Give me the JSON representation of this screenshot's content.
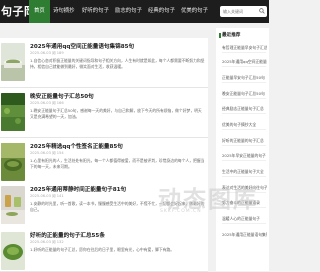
{
  "nav": {
    "logo": "句子岡",
    "items": [
      "首页",
      "诗句摘抄",
      "好听的句子",
      "励志的句子",
      "经典的句子",
      "优美的句子"
    ],
    "active_index": 0
  },
  "search": {
    "placeholder": "输入关键词"
  },
  "articles": [
    {
      "title": "2025年通用qq空间正能量语句集锦85句",
      "meta": "2025-06-03   阅 189",
      "excerpt": "1.自信心态对积极正能量的关键词指导和句子相关方向，人生有时就是如此，每个人都需要不断努力和坚持，相信自己就能做到最好，微笑面对生活，收获温暖。"
    },
    {
      "title": "晚安正能量句子汇总50句",
      "meta": "2025-06-03   阅 166",
      "excerpt": "1.晚安正能量句子汇总50句，感谢每一天的美好，与自己和解，放下今天的所有烦恼，做个好梦，明天又是充满希望的一天，加油。"
    },
    {
      "title": "2025年精选qq个性签名正能量85句",
      "meta": "2025-06-03   阅 154",
      "excerpt": "1.心里有阳光的人，生活处处有阳光，每一个人都值得被爱，而不是被评判，珍惜身边的每个人，把握当下的每一天，未来可期。"
    },
    {
      "title": "2025年通用蒂静时间正能量句子81句",
      "meta": "2025-06-03   阅 141",
      "excerpt": "1.安静的时光里，听一首歌，读一本书，慢慢感受生活中的美好，不慌不忙，一切都会好起来，做最好的自己。"
    },
    {
      "title": "好听的正能量的句子汇总55条",
      "meta": "2025-06-03   阅 132",
      "excerpt": "1.好听的正能量的句子汇总，愿你在往后的日子里，眼里有光，心中有爱，脚下有路。"
    }
  ],
  "sidebar": {
    "title": "最近推荐",
    "items": [
      "有哲理正能量早安句子汇总",
      "2025年通用qq空间正能量",
      "正能量早安句子汇总50句",
      "晚安正能量句子汇总50句",
      "经典励志正能量句子汇总",
      "优美的句子摘抄大全",
      "好听的正能量的句子汇总",
      "2025年早安正能量的句子",
      "生活中的正能量句子大全",
      "表达对生活的美好向往句子",
      "努力奋斗的正能量语录",
      "温暖人心的正能量句子",
      "2025年通用正能量语句集锦"
    ]
  },
  "watermark": {
    "main": "动态图库",
    "sub": "SKKF.COM.CN"
  }
}
